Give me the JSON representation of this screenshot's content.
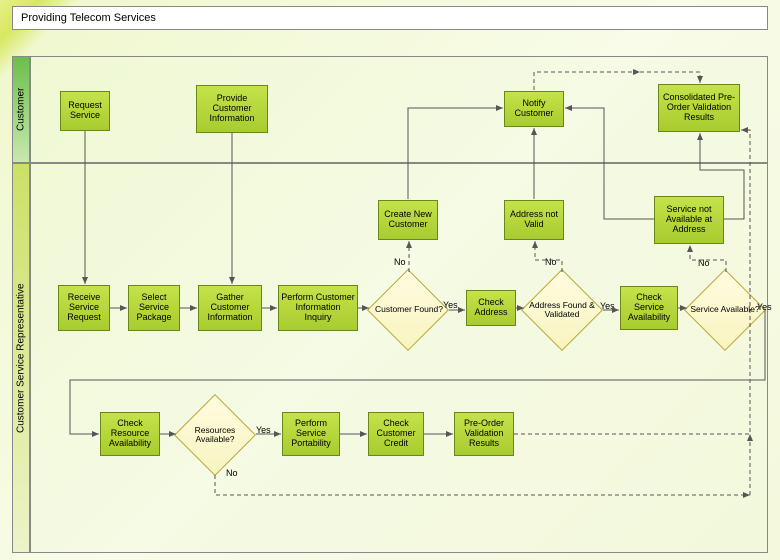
{
  "title": "Providing Telecom Services",
  "lanes": {
    "customer": "Customer",
    "csr": "Customer Service Representative"
  },
  "nodes": {
    "requestService": "Request Service",
    "provideCustInfo": "Provide Customer Information",
    "notifyCustomer": "Notify Customer",
    "consolidatedResults": "Consolidated Pre-Order Validation Results",
    "receiveService": "Receive Service Request",
    "selectPackage": "Select Service Package",
    "gatherInfo": "Gather Customer Information",
    "performInquiry": "Perform Customer Information Inquiry",
    "customerFound": "Customer Found?",
    "createNew": "Create New Customer",
    "checkAddress": "Check Address",
    "addressValidated": "Address Found & Validated",
    "addressNotValid": "Address not Valid",
    "checkServiceAvail": "Check Service Availability",
    "serviceAvailable": "Service Available?",
    "serviceNotAvail": "Service not Available at Address",
    "checkResource": "Check Resource Availability",
    "resourcesAvailable": "Resources Available?",
    "performPortability": "Perform Service Portability",
    "checkCredit": "Check Customer Credit",
    "preOrderResults": "Pre-Order Validation Results"
  },
  "labels": {
    "yes": "Yes",
    "no": "No"
  }
}
